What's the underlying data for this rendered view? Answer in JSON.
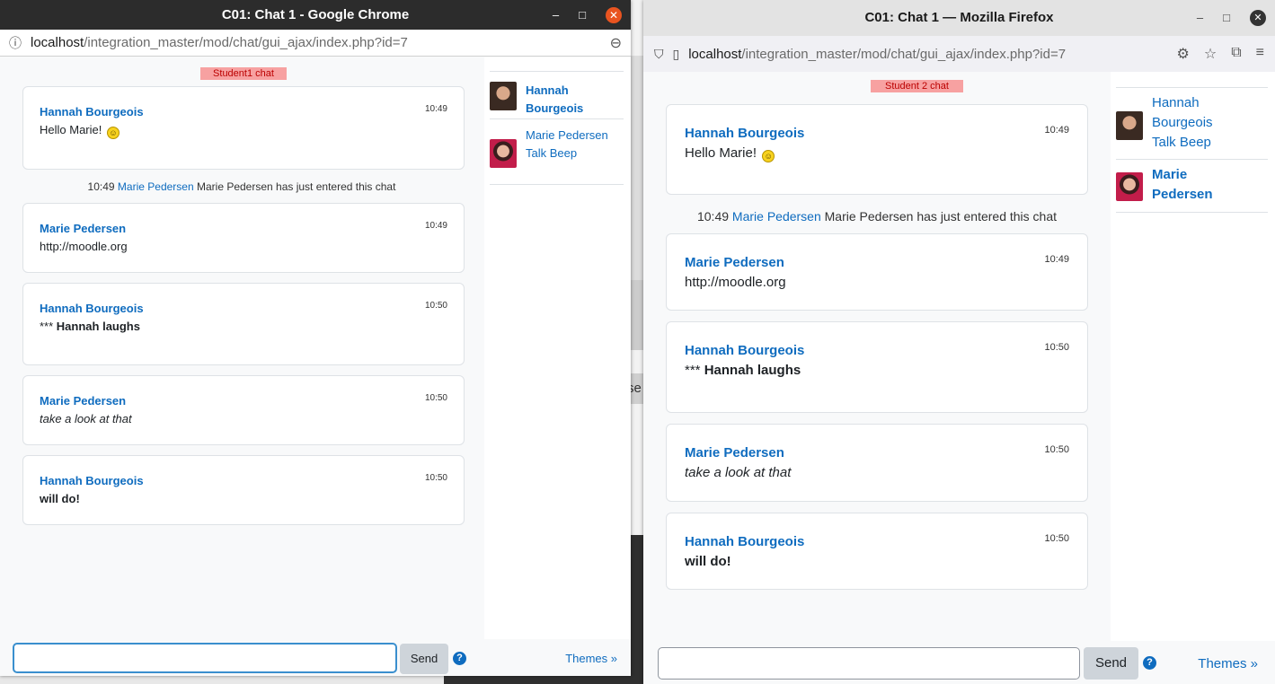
{
  "chrome": {
    "title": "C01: Chat 1 - Google Chrome",
    "url_host": "localhost",
    "url_path": "/integration_master/mod/chat/gui_ajax/index.php?id=7",
    "chat_label": "Student1 chat"
  },
  "firefox": {
    "title": "C01: Chat 1 — Mozilla Firefox",
    "url_host": "localhost",
    "url_path": "/integration_master/mod/chat/gui_ajax/index.php?id=7",
    "chat_label": "Student 2 chat"
  },
  "messages": [
    {
      "user": "Hannah Bourgeois",
      "time": "10:49",
      "text": "Hello Marie!",
      "style": "normal",
      "emoji": "smiley"
    },
    {
      "user": "Marie Pedersen",
      "time": "10:49",
      "text": "http://moodle.org",
      "style": "link"
    },
    {
      "user": "Hannah Bourgeois",
      "time": "10:50",
      "prefix": "*** ",
      "text": "Hannah laughs",
      "style": "bold"
    },
    {
      "user": "Marie Pedersen",
      "time": "10:50",
      "text": "take a look at that",
      "style": "italic"
    },
    {
      "user": "Hannah Bourgeois",
      "time": "10:50",
      "text": "will do!",
      "style": "bold"
    }
  ],
  "system_message": {
    "time": "10:49",
    "user": "Marie Pedersen",
    "text": "Marie Pedersen has just entered this chat"
  },
  "users": [
    {
      "name": "Hannah Bourgeois",
      "avatar": "avatar-hannah"
    },
    {
      "name": "Marie Pedersen",
      "avatar": "avatar-marie"
    }
  ],
  "talk_label": "Talk",
  "beep_label": "Beep",
  "send_label": "Send",
  "help_label": "?",
  "themes_label": "Themes »",
  "desktop_fragment": "se",
  "icons": {
    "info": "ⓘ",
    "zoom": "⊖",
    "shield": "⛉",
    "page": "▯",
    "extension": "⚙",
    "star": "☆",
    "puzzle": "⧉",
    "menu": "≡",
    "minimize": "–",
    "maximize": "□",
    "close": "✕"
  }
}
